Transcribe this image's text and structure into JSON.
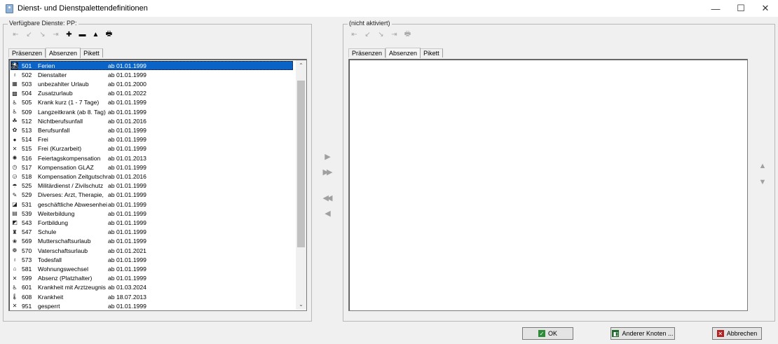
{
  "window": {
    "title": "Dienst- und Dienstpalettendefinitionen",
    "controls": {
      "minimize": "—",
      "maximize": "☐",
      "close": "✕"
    }
  },
  "left": {
    "group_label": "Verfügbare Dienste: PP:",
    "toolbar": [
      {
        "name": "first-icon",
        "glyph": "⇤",
        "enabled": false
      },
      {
        "name": "prev-icon",
        "glyph": "↙",
        "enabled": false
      },
      {
        "name": "next-icon",
        "glyph": "↘",
        "enabled": false
      },
      {
        "name": "last-icon",
        "glyph": "⇥",
        "enabled": false
      },
      {
        "name": "add-icon",
        "glyph": "✚",
        "enabled": true
      },
      {
        "name": "remove-icon",
        "glyph": "▬",
        "enabled": true
      },
      {
        "name": "up-icon",
        "glyph": "▲",
        "enabled": true
      },
      {
        "name": "print-icon",
        "glyph": "🖶",
        "enabled": true
      }
    ],
    "tabs": [
      "Präsenzen",
      "Absenzen",
      "Pikett"
    ],
    "active_tab": 1,
    "items": [
      {
        "icon": "vacation-icon",
        "glyph": "⛱",
        "code": "501",
        "name": "Ferien",
        "date": "ab 01.01.1999"
      },
      {
        "icon": "lightbulb-icon",
        "glyph": "♁",
        "code": "502",
        "name": "Dienstalter",
        "date": "ab 01.01.1999"
      },
      {
        "icon": "calendar-icon",
        "glyph": "▦",
        "code": "503",
        "name": "unbezahlter Urlaub",
        "date": "ab 01.01.2000"
      },
      {
        "icon": "extra-leave-icon",
        "glyph": "▩",
        "code": "504",
        "name": "Zusatzurlaub",
        "date": "ab 01.01.2022"
      },
      {
        "icon": "crutch-icon",
        "glyph": "♿",
        "code": "505",
        "name": "Krank kurz (1 - 7 Tage)",
        "date": "ab 01.01.1999"
      },
      {
        "icon": "crutch-icon",
        "glyph": "♿",
        "code": "509",
        "name": "Langzeitkrank (ab 8. Tag)",
        "date": "ab 01.01.1999"
      },
      {
        "icon": "accident-icon",
        "glyph": "☘",
        "code": "512",
        "name": "Nichtberufsunfall",
        "date": "ab 01.01.2016"
      },
      {
        "icon": "accident-icon",
        "glyph": "✿",
        "code": "513",
        "name": "Berufsunfall",
        "date": "ab 01.01.1999"
      },
      {
        "icon": "dot-icon",
        "glyph": "●",
        "code": "514",
        "name": "Frei",
        "date": "ab 01.01.1999"
      },
      {
        "icon": "cross-icon",
        "glyph": "✕",
        "code": "515",
        "name": "Frei (Kurzarbeit)",
        "date": "ab 01.01.1999"
      },
      {
        "icon": "holiday-icon",
        "glyph": "✺",
        "code": "516",
        "name": "Feiertagskompensation",
        "date": "ab 01.01.2013"
      },
      {
        "icon": "clock-icon",
        "glyph": "◷",
        "code": "517",
        "name": "Kompensation GLAZ",
        "date": "ab 01.01.1999"
      },
      {
        "icon": "clock-icon",
        "glyph": "◶",
        "code": "518",
        "name": "Kompensation Zeitgutschri",
        "date": "ab 01.01.2016"
      },
      {
        "icon": "military-icon",
        "glyph": "☂",
        "code": "525",
        "name": "Militärdienst / Zivilschutz",
        "date": "ab 01.01.1999"
      },
      {
        "icon": "edit-icon",
        "glyph": "✎",
        "code": "529",
        "name": "Diverses: Arzt, Therapie,",
        "date": "ab 01.01.1999"
      },
      {
        "icon": "business-icon",
        "glyph": "◪",
        "code": "531",
        "name": "geschäftliche Abwesenhei",
        "date": "ab 01.01.1999"
      },
      {
        "icon": "book-icon",
        "glyph": "▤",
        "code": "539",
        "name": "Weiterbildung",
        "date": "ab 01.01.1999"
      },
      {
        "icon": "training-icon",
        "glyph": "◩",
        "code": "543",
        "name": "Fortbildung",
        "date": "ab 01.01.1999"
      },
      {
        "icon": "school-icon",
        "glyph": "♜",
        "code": "547",
        "name": "Schule",
        "date": "ab 01.01.1999"
      },
      {
        "icon": "maternity-icon",
        "glyph": "❀",
        "code": "569",
        "name": "Mutterschaftsurlaub",
        "date": "ab 01.01.1999"
      },
      {
        "icon": "paternity-icon",
        "glyph": "❁",
        "code": "570",
        "name": "Vaterschaftsurlaub",
        "date": "ab 01.01.2021"
      },
      {
        "icon": "candle-icon",
        "glyph": "♁",
        "code": "573",
        "name": "Todesfall",
        "date": "ab 01.01.1999"
      },
      {
        "icon": "moving-icon",
        "glyph": "⌂",
        "code": "581",
        "name": "Wohnungswechsel",
        "date": "ab 01.01.1999"
      },
      {
        "icon": "cross-icon",
        "glyph": "✕",
        "code": "599",
        "name": "Absenz (Platzhalter)",
        "date": "ab 01.01.1999"
      },
      {
        "icon": "crutch-icon",
        "glyph": "♿",
        "code": "601",
        "name": "Krankheit mit Arztzeugnis",
        "date": "ab 01.03.2024"
      },
      {
        "icon": "thermometer-icon",
        "glyph": "🌡",
        "code": "608",
        "name": "Krankheit",
        "date": "ab 18.07.2013"
      },
      {
        "icon": "cross-icon",
        "glyph": "✕",
        "code": "951",
        "name": "gesperrt",
        "date": "ab 01.01.1999"
      }
    ],
    "selected_index": 0
  },
  "transfer": {
    "add_one": "▶",
    "add_all": "▶▶",
    "remove_all": "◀◀",
    "remove_one": "◀"
  },
  "right": {
    "group_label": "(nicht aktiviert)",
    "toolbar": [
      {
        "name": "first-icon",
        "glyph": "⇤",
        "enabled": false
      },
      {
        "name": "prev-icon",
        "glyph": "↙",
        "enabled": false
      },
      {
        "name": "next-icon",
        "glyph": "↘",
        "enabled": false
      },
      {
        "name": "last-icon",
        "glyph": "⇥",
        "enabled": false
      },
      {
        "name": "print-icon",
        "glyph": "🖶",
        "enabled": false
      }
    ],
    "tabs": [
      "Präsenzen",
      "Absenzen",
      "Pikett"
    ],
    "active_tab": 1
  },
  "order": {
    "up": "▲",
    "down": "▼"
  },
  "buttons": {
    "ok": "OK",
    "other_node": "Anderer Knoten ...",
    "cancel": "Abbrechen"
  },
  "colors": {
    "selection": "#0a64c8",
    "ok_icon": "#2e8b3a",
    "node_icon": "#1e6b2a",
    "cancel_icon": "#b22222"
  }
}
